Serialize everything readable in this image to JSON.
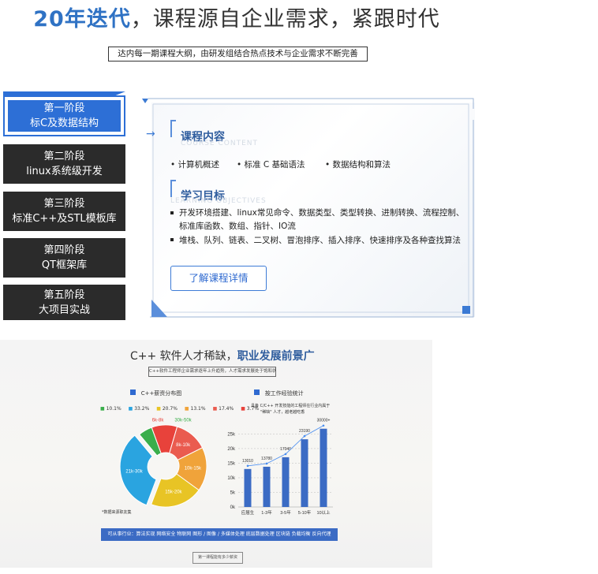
{
  "header": {
    "title_highlight": "20年迭代",
    "title_rest": "，课程源自企业需求，紧跟时代",
    "subtitle": "达内每一期课程大纲，由研发组结合热点技术与企业需求不断完善"
  },
  "stages": [
    {
      "line1": "第一阶段",
      "line2": "标C及数据结构",
      "active": true
    },
    {
      "line1": "第二阶段",
      "line2": "linux系统级开发",
      "active": false
    },
    {
      "line1": "第三阶段",
      "line2": "标准C++及STL模板库",
      "active": false
    },
    {
      "line1": "第四阶段",
      "line2": "QT框架库",
      "active": false
    },
    {
      "line1": "第五阶段",
      "line2": "大项目实战",
      "active": false
    }
  ],
  "panel": {
    "content_title": "课程内容",
    "content_ghost": "COURSE CONTENT",
    "content_items": [
      "计算机概述",
      "标准 C 基础语法",
      "数据结构和算法"
    ],
    "goal_title": "学习目标",
    "goal_ghost": "LEARNING OBJECTIVES",
    "goal_items": [
      "开发环境搭建、linux常见命令、数据类型、类型转换、进制转换、流程控制、",
      "标准库函数、数组、指针、IO流",
      "堆栈、队列、链表、二叉树、冒泡排序、插入排序、快速排序及各种查找算法"
    ],
    "detail_button": "了解课程详情"
  },
  "promo": {
    "title_plain": "C++ 软件人才稀缺，",
    "title_highlight": "职业发展前景广",
    "subtitle": "C++软件工程师企业需求逐年上升趋势，人才需求发展处于饱和状态",
    "pie_legend_title": "C++薪资分布图",
    "bar_legend_title": "按工作经验统计",
    "bar_note_line1": "具备 C/C++ 开发技能的工程师在行业内属于",
    "bar_note_line2": "\"稀缺\" 人才，越老越吃香",
    "pie_footnote": "*数据来源职友集",
    "industry_text": "可从事行业：算法实现 网络安全 物联网 图形 / 图像 / 多媒体处理 底层数据处理 区块链 负载均衡 反向代理",
    "more_button": "第一课程能有多少薪资"
  },
  "chart_data": [
    {
      "type": "pie",
      "title": "C++薪资分布图",
      "categories": [
        "6k-8k",
        "8k-10k",
        "10k-15k",
        "15k-20k",
        "21k-30k",
        "30k-50k"
      ],
      "legend": [
        "10.1%",
        "33.2%",
        "20.7%",
        "13.1%",
        "17.4%",
        "3.7%"
      ],
      "legend_colors": [
        "#3aae4b",
        "#2aa4e0",
        "#e8c425",
        "#f0a33a",
        "#ea5b4f",
        "#e8423b"
      ],
      "values": [
        10.1,
        13.1,
        17.4,
        20.7,
        33.2,
        5.5
      ],
      "colors": [
        "#e8423b",
        "#ea5b4f",
        "#f0a33a",
        "#e8c425",
        "#2aa4e0",
        "#3aae4b"
      ]
    },
    {
      "type": "bar",
      "title": "按工作经验统计",
      "categories": [
        "应届生",
        "1-3年",
        "3-5年",
        "5-10年",
        "10以上"
      ],
      "values": [
        13010,
        13780,
        17040,
        23190,
        26800
      ],
      "value_labels": [
        "13010",
        "13780",
        "17040",
        "23190",
        "30000+"
      ],
      "yticks": [
        "0k",
        "5k",
        "10k",
        "15k",
        "20k",
        "25k"
      ],
      "ylim": [
        0,
        27000
      ],
      "color": "#3b6bc4"
    }
  ],
  "colors": {
    "accent": "#2d6fd6",
    "title_blue": "#2f72c4",
    "dark_tab": "#2b2b2b"
  }
}
